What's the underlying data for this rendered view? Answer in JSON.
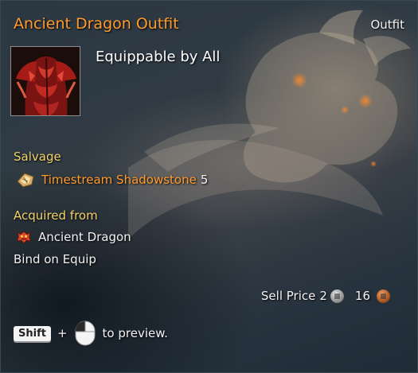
{
  "item": {
    "name": "Ancient Dragon Outfit",
    "type": "Outfit",
    "equip_text": "Equippable by All",
    "thumbnail_icon": "dragon-outfit-thumbnail"
  },
  "salvage": {
    "heading": "Salvage",
    "material_icon": "timestream-shadowstone-icon",
    "material_name": "Timestream Shadowstone",
    "quantity": "5"
  },
  "acquired": {
    "heading": "Acquired from",
    "source_icon": "ancient-dragon-icon",
    "source_name": "Ancient Dragon"
  },
  "bind_text": "Bind on Equip",
  "sell": {
    "label": "Sell Price",
    "silver_amount": "2",
    "copper_amount": "16",
    "silver_icon": "silver-coin-icon",
    "copper_icon": "copper-coin-icon"
  },
  "preview_hint": {
    "key_label": "Shift",
    "plus": "+",
    "mouse_icon": "mouse-left-click-icon",
    "text": "to preview."
  },
  "colors": {
    "title": "#ff9b2e",
    "section_heading": "#f2d16a",
    "material_name": "#ff9b2e",
    "body_text": "#f2f2f2"
  }
}
